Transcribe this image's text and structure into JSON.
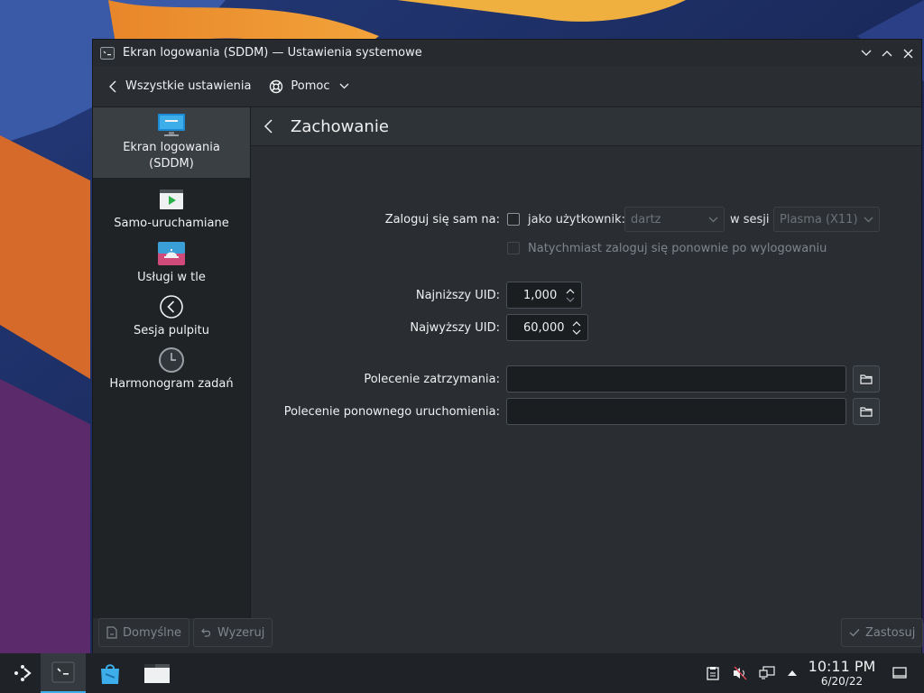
{
  "colors": {
    "accent": "#3daee9",
    "window_bg": "#2a2e32",
    "sidebar_bg": "#202326",
    "field_bg": "#1b1e20"
  },
  "window": {
    "title": "Ekran logowania (SDDM) — Ustawienia systemowe",
    "app_icon": "terminal-like-icon",
    "controls": [
      "minimize",
      "maximize",
      "close"
    ]
  },
  "toolbar": {
    "back_label": "Wszystkie ustawienia",
    "help_label": "Pomoc"
  },
  "sidebar": {
    "items": [
      {
        "label_line1": "Ekran logowania",
        "label_line2": "(SDDM)",
        "icon": "monitor-icon",
        "active": true
      },
      {
        "label_line1": "Samo-uruchamiane",
        "icon": "play-icon"
      },
      {
        "label_line1": "Usługi w tle",
        "icon": "bell-service-icon"
      },
      {
        "label_line1": "Sesja pulpitu",
        "icon": "back-circle-icon"
      },
      {
        "label_line1": "Harmonogram zadań",
        "icon": "clock-icon"
      }
    ]
  },
  "page": {
    "title": "Zachowanie",
    "autologin": {
      "label": "Zaloguj się sam na:",
      "user_label": "jako użytkownik:",
      "user_value": "dartz",
      "session_label": "w sesji",
      "session_value": "Plasma (X11)",
      "relogin_label": "Natychmiast zaloguj się ponownie po wylogowaniu"
    },
    "min_uid": {
      "label": "Najniższy UID:",
      "value": "1,000"
    },
    "max_uid": {
      "label": "Najwyższy UID:",
      "value": "60,000"
    },
    "halt_cmd": {
      "label": "Polecenie zatrzymania:",
      "value": ""
    },
    "reboot_cmd": {
      "label": "Polecenie ponownego uruchomienia:",
      "value": ""
    }
  },
  "footer": {
    "defaults_label": "Domyślne",
    "reset_label": "Wyzeruj",
    "apply_label": "Zastosuj"
  },
  "taskbar": {
    "time": "10:11 PM",
    "date": "6/20/22"
  }
}
